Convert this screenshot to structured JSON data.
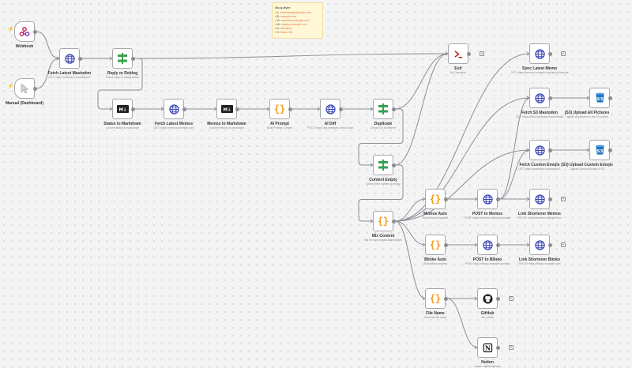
{
  "canvas": {
    "background": "#f4f4f5",
    "edge_color": "#8d8d95"
  },
  "sticky": {
    "title": "Go-a-tryer",
    "lines": [
      {
        "prefix": "• X:",
        "link": "cheerfoxsays@twitter.com"
      },
      {
        "prefix": "• Bl:",
        "link": "example.com"
      },
      {
        "prefix": "• Mi:",
        "link": "mastodon.example.com"
      },
      {
        "prefix": "• Mi:",
        "link": "misskey.example.com"
      },
      {
        "prefix": "• Ai:",
        "link": "aicontent"
      },
      {
        "prefix": "• N:",
        "link": "Notion DB"
      }
    ]
  },
  "nodes": [
    {
      "id": "webhook",
      "label": "Webhook",
      "sub": "",
      "icon": "webhook-icon",
      "trigger": true
    },
    {
      "id": "manual",
      "label": "Manual (Dashboard)",
      "sub": "",
      "icon": "cursor-icon",
      "trigger": true
    },
    {
      "id": "fetch_latest_mastodon",
      "label": "Fetch Latest Mastodon",
      "sub": "GET: https://mastodon.social/api/v1",
      "icon": "globe-icon"
    },
    {
      "id": "reply_or_reblog",
      "label": "Reply or Reblog",
      "sub": "Check reply or reblog status",
      "icon": "switch-icon"
    },
    {
      "id": "exit",
      "label": "Exit",
      "sub": "No Operation",
      "icon": "terminal-icon"
    },
    {
      "id": "status_to_markdown",
      "label": "Status to Markdown",
      "sub": "Convert status to markdown",
      "icon": "markdown-icon"
    },
    {
      "id": "fetch_latest_memos",
      "label": "Fetch Latest Memos",
      "sub": "GET: https://memos.example.com",
      "icon": "globe-icon"
    },
    {
      "id": "memos_to_markdown",
      "label": "Memos to Markdown",
      "sub": "Convert memos to markdown",
      "icon": "markdown-icon"
    },
    {
      "id": "ai_prompt",
      "label": "AI Prompt",
      "sub": "Build Prompt Content",
      "icon": "braces-icon"
    },
    {
      "id": "ai_diff",
      "label": "AI Diff",
      "sub": "POST: https://api.example.com/v1/chat",
      "icon": "globe-icon"
    },
    {
      "id": "duplicate",
      "label": "Duplicate",
      "sub": "Check if AI is different",
      "icon": "switch-icon"
    },
    {
      "id": "content_empty",
      "label": "Content Empty",
      "sub": "Check if the content is empty",
      "icon": "switch-icon"
    },
    {
      "id": "mix_content",
      "label": "Mix Content",
      "sub": "Mix text and media attachments",
      "icon": "braces-icon"
    },
    {
      "id": "memos_auto",
      "label": "Memos Auto",
      "sub": "Build memos request",
      "icon": "braces-icon"
    },
    {
      "id": "blinko_auto",
      "label": "Blinko Auto",
      "sub": "Build blinko request",
      "icon": "braces-icon"
    },
    {
      "id": "file_name",
      "label": "File Name",
      "sub": "Generate file name",
      "icon": "braces-icon"
    },
    {
      "id": "post_to_memos",
      "label": "POST to Memos",
      "sub": "POST: https://memos.example.com/api",
      "icon": "globe-icon"
    },
    {
      "id": "post_to_blinko",
      "label": "POST to Blinko",
      "sub": "POST: https://blinko.example.com/api",
      "icon": "globe-icon"
    },
    {
      "id": "github",
      "label": "GitHub",
      "sub": "file: create",
      "icon": "github-icon"
    },
    {
      "id": "notion",
      "label": "Notion",
      "sub": "create: databasePage",
      "icon": "notion-icon"
    },
    {
      "id": "sync_to_server",
      "label": "Sync Latest Memo",
      "sub": "GET: https://memos.example.com/api/v1/memos",
      "icon": "globe-icon"
    },
    {
      "id": "fetch_s3_mastodon",
      "label": "Fetch S3 Mastodon",
      "sub": "GET: https://files.mastodon.social/media",
      "icon": "globe-icon"
    },
    {
      "id": "fetch_custom_emojis",
      "label": "Fetch Custom Emojis",
      "sub": "GET: https://mastodon.social/api/v1",
      "icon": "globe-icon"
    },
    {
      "id": "link_shortener_memos",
      "label": "Link Shortener Memos",
      "sub": "PATCH: https://memos.example.com",
      "icon": "globe-icon"
    },
    {
      "id": "link_shortener_blinko",
      "label": "Link Shortener Blinko",
      "sub": "PATCH: https://blinko.example.com",
      "icon": "globe-icon"
    },
    {
      "id": "s3_upload_all_pictures",
      "label": "(S3) Upload All Pictures",
      "sub": "Upload all pictures to the S3 bucket",
      "icon": "s3-bucket-icon"
    },
    {
      "id": "s3_upload_custom_emojis",
      "label": "(S3) Upload Custom Emojis",
      "sub": "Upload Custom Emojis to S3",
      "icon": "s3-bucket-icon"
    }
  ]
}
